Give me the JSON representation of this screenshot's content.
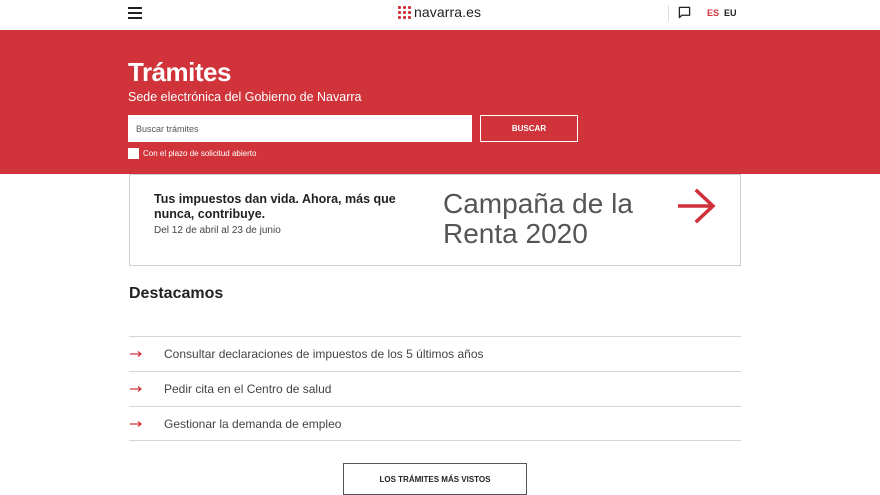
{
  "header": {
    "logo_text": "navarra.es",
    "languages": [
      {
        "code": "ES",
        "active": true
      },
      {
        "code": "EU",
        "active": false
      }
    ]
  },
  "hero": {
    "title": "Trámites",
    "subtitle": "Sede electrónica del Gobierno de Navarra",
    "search_placeholder": "Buscar trámites",
    "search_button": "BUSCAR",
    "checkbox_label": "Con el plazo de solicitud abierto",
    "checkbox_checked": false,
    "bg_color": "#d0343a"
  },
  "campaign": {
    "headline": "Tus impuestos dan vida. Ahora, más que nunca, contribuye.",
    "dates": "Del 12 de abril al 23 de junio",
    "big_text_line1": "Campaña de la",
    "big_text_line2": "Renta 2020"
  },
  "featured": {
    "title": "Destacamos",
    "items": [
      {
        "label": "Consultar declaraciones de impuestos de los 5 últimos años"
      },
      {
        "label": "Pedir cita en el Centro de salud"
      },
      {
        "label": "Gestionar la demanda de empleo"
      }
    ],
    "more_button": "LOS TRÁMITES MÁS VISTOS"
  },
  "colors": {
    "accent": "#d0303a"
  }
}
